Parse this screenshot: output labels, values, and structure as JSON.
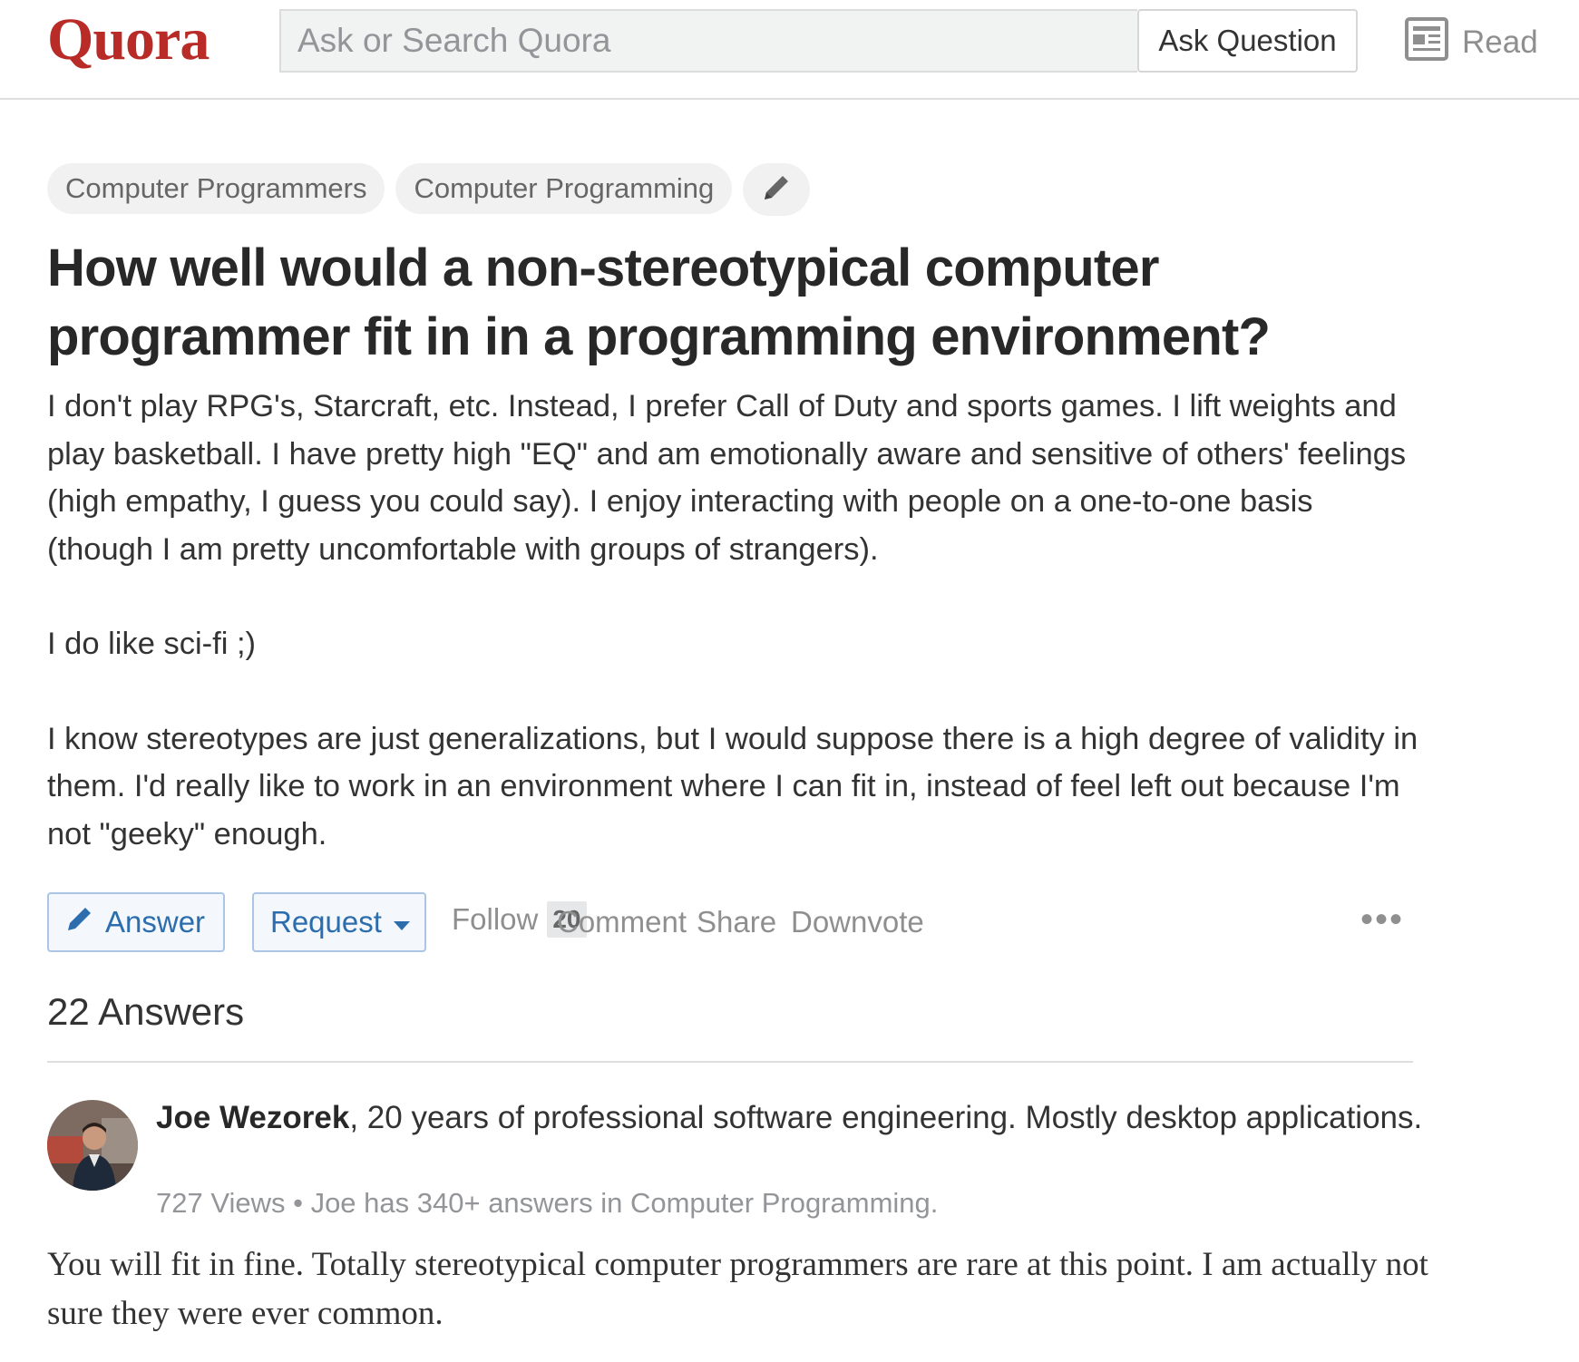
{
  "header": {
    "logo": "Quora",
    "search_placeholder": "Ask or Search Quora",
    "ask_button": "Ask Question",
    "read_label": "Read",
    "read_icon": "newspaper-icon"
  },
  "topics": [
    "Computer Programmers",
    "Computer Programming"
  ],
  "topic_edit_icon": "pencil-icon",
  "question": {
    "title": "How well would a non-stereotypical computer programmer fit in in a programming environment?",
    "body": [
      "I don't play RPG's, Starcraft, etc. Instead, I prefer Call of Duty and sports games. I lift weights and play basketball. I have pretty high \"EQ\" and am emotionally aware and sensitive of others' feelings (high empathy, I guess you could say). I enjoy interacting with people on a one-to-one basis (though I am pretty uncomfortable with groups of strangers).",
      "I do like sci-fi ;)",
      "I know stereotypes are just generalizations, but I would suppose there is a high degree of validity in them. I'd really like to work in an environment where I can fit in, instead of feel left out because I'm not \"geeky\" enough."
    ]
  },
  "actions": {
    "answer": "Answer",
    "request": "Request",
    "follow": "Follow",
    "follow_count": "20",
    "comment": "Comment",
    "share": "Share",
    "downvote": "Downvote",
    "more": "•••"
  },
  "answers": {
    "count_label": "22 Answers",
    "items": [
      {
        "author": "Joe Wezorek",
        "credential": ", 20 years of professional software engineering. Mostly desktop applications.",
        "views": "727 Views",
        "separator": " • ",
        "context": "Joe has 340+ answers in Computer Programming.",
        "text": "You will fit in fine. Totally stereotypical computer programmers are rare at this point. I am actually not sure they were ever common."
      }
    ]
  },
  "colors": {
    "brand": "#b92b27",
    "link_blue": "#2b6dad",
    "muted": "#8f8f8f"
  }
}
